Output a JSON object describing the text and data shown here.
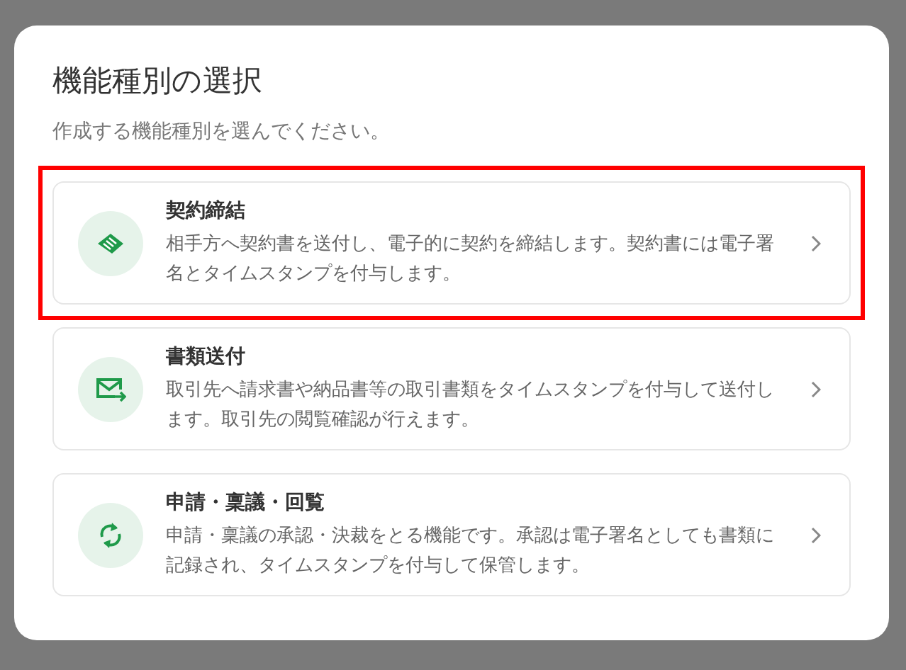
{
  "dialog": {
    "title": "機能種別の選択",
    "subtitle": "作成する機能種別を選んでください。"
  },
  "options": [
    {
      "kind": "contract",
      "title": "契約締結",
      "description": "相手方へ契約書を送付し、電子的に契約を締結します。契約書には電子署名とタイムスタンプを付与します。",
      "highlighted": true
    },
    {
      "kind": "send",
      "title": "書類送付",
      "description": "取引先へ請求書や納品書等の取引書類をタイムスタンプを付与して送付します。取引先の閲覧確認が行えます。",
      "highlighted": false
    },
    {
      "kind": "approval",
      "title": "申請・稟議・回覧",
      "description": "申請・稟議の承認・決裁をとる機能です。承認は電子署名としても書類に記録され、タイムスタンプを付与して保管します。",
      "highlighted": false
    }
  ]
}
